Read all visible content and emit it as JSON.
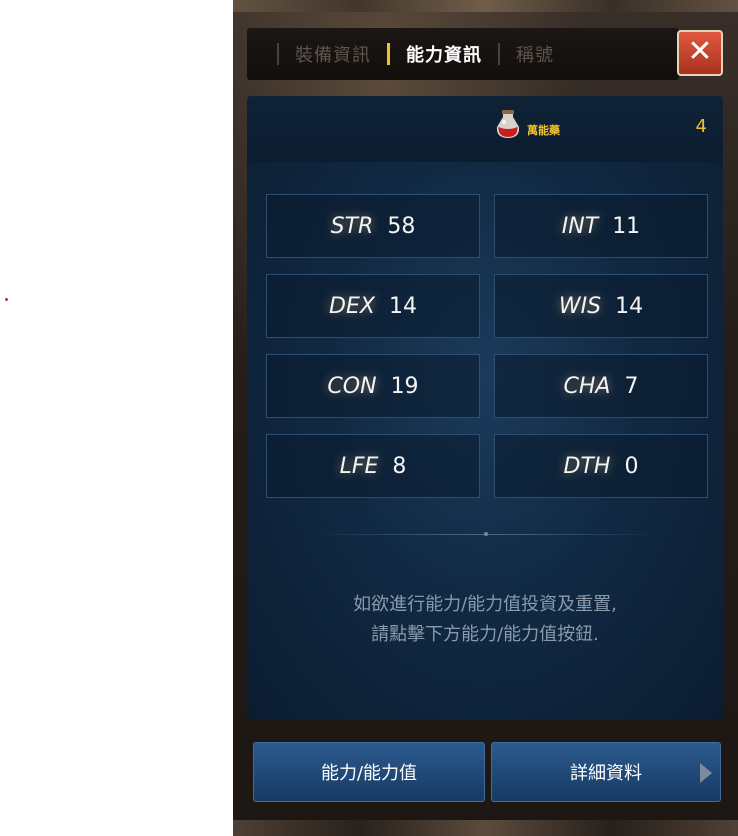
{
  "tabs": [
    {
      "label": "裝備資訊",
      "active": false
    },
    {
      "label": "能力資訊",
      "active": true
    },
    {
      "label": "稱號",
      "active": false
    }
  ],
  "close_icon": "close-icon",
  "potion": {
    "icon": "potion-icon",
    "label": "萬能藥",
    "count": "4"
  },
  "stats": [
    {
      "name": "STR",
      "value": "58"
    },
    {
      "name": "INT",
      "value": "11"
    },
    {
      "name": "DEX",
      "value": "14"
    },
    {
      "name": "WIS",
      "value": "14"
    },
    {
      "name": "CON",
      "value": "19"
    },
    {
      "name": "CHA",
      "value": "7"
    },
    {
      "name": "LFE",
      "value": "8"
    },
    {
      "name": "DTH",
      "value": "0"
    }
  ],
  "help": {
    "line1": "如欲進行能力/能力值投資及重置,",
    "line2": "請點擊下方能力/能力值按鈕."
  },
  "buttons": {
    "ability": "能力/能力值",
    "details": "詳細資料"
  },
  "colors": {
    "accent": "#f0c030",
    "close": "#c8442b",
    "panel": "#112a44",
    "button": "#234a78"
  }
}
